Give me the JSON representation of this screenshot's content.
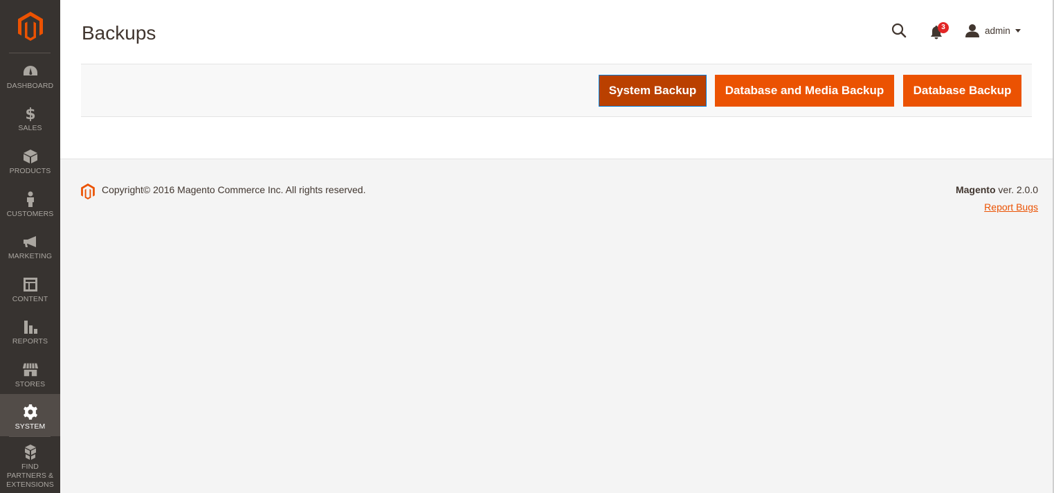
{
  "sidebar": {
    "items": [
      {
        "label": "DASHBOARD",
        "icon": "dashboard-icon"
      },
      {
        "label": "SALES",
        "icon": "dollar-icon"
      },
      {
        "label": "PRODUCTS",
        "icon": "box-icon"
      },
      {
        "label": "CUSTOMERS",
        "icon": "person-icon"
      },
      {
        "label": "MARKETING",
        "icon": "megaphone-icon"
      },
      {
        "label": "CONTENT",
        "icon": "layout-icon"
      },
      {
        "label": "REPORTS",
        "icon": "bar-chart-icon"
      },
      {
        "label": "STORES",
        "icon": "storefront-icon"
      },
      {
        "label": "SYSTEM",
        "icon": "gear-icon",
        "active": true
      },
      {
        "label": "FIND PARTNERS & EXTENSIONS",
        "icon": "cubes-icon"
      }
    ]
  },
  "header": {
    "title": "Backups",
    "notifications_count": "3",
    "user_name": "admin"
  },
  "actions": {
    "system_backup": "System Backup",
    "db_media_backup": "Database and Media Backup",
    "db_backup": "Database Backup"
  },
  "footer": {
    "copyright": "Copyright© 2016 Magento Commerce Inc. All rights reserved.",
    "brand": "Magento",
    "version": " ver. 2.0.0",
    "report_bugs": "Report Bugs"
  },
  "colors": {
    "accent": "#eb5202",
    "accent_dark": "#ba4000",
    "sidebar_bg": "#373330",
    "sidebar_active": "#524c48"
  }
}
